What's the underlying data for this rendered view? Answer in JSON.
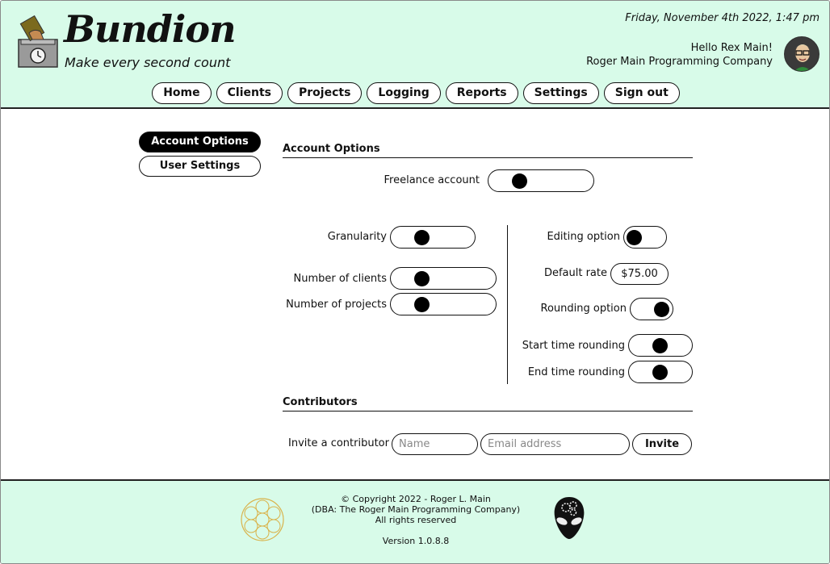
{
  "header": {
    "brand": "Bundion",
    "tagline": "Make every second count",
    "datetime": "Friday, November 4th 2022, 1:47 pm",
    "greeting": "Hello Rex Main!",
    "company": "Roger Main Programming Company"
  },
  "nav": {
    "items": [
      "Home",
      "Clients",
      "Projects",
      "Logging",
      "Reports",
      "Settings",
      "Sign out"
    ]
  },
  "sidebar": {
    "items": [
      {
        "label": "Account Options",
        "active": true
      },
      {
        "label": "User Settings",
        "active": false
      }
    ]
  },
  "account_options": {
    "title": "Account Options",
    "freelance_label": "Freelance account",
    "freelance_on": false,
    "granularity_label": "Granularity",
    "granularity_on": false,
    "clients_label": "Number of clients",
    "clients_on": false,
    "projects_label": "Number of projects",
    "projects_on": false,
    "editing_label": "Editing option",
    "editing_on": false,
    "rate_label": "Default rate",
    "rate_value": "$75.00",
    "rounding_label": "Rounding option",
    "rounding_on": true,
    "start_rounding_label": "Start time rounding",
    "start_rounding_on": true,
    "end_rounding_label": "End time rounding",
    "end_rounding_on": true
  },
  "contributors": {
    "title": "Contributors",
    "invite_label": "Invite a contributor",
    "name_placeholder": "Name",
    "email_placeholder": "Email address",
    "invite_button": "Invite"
  },
  "footer": {
    "copyright": "© Copyright 2022 - Roger L. Main",
    "dba": "(DBA: The Roger Main Programming Company)",
    "rights": "All rights reserved",
    "version": "Version 1.0.8.8"
  },
  "colors": {
    "mint_bg": "#d8fbe9",
    "accent": "#000000"
  }
}
